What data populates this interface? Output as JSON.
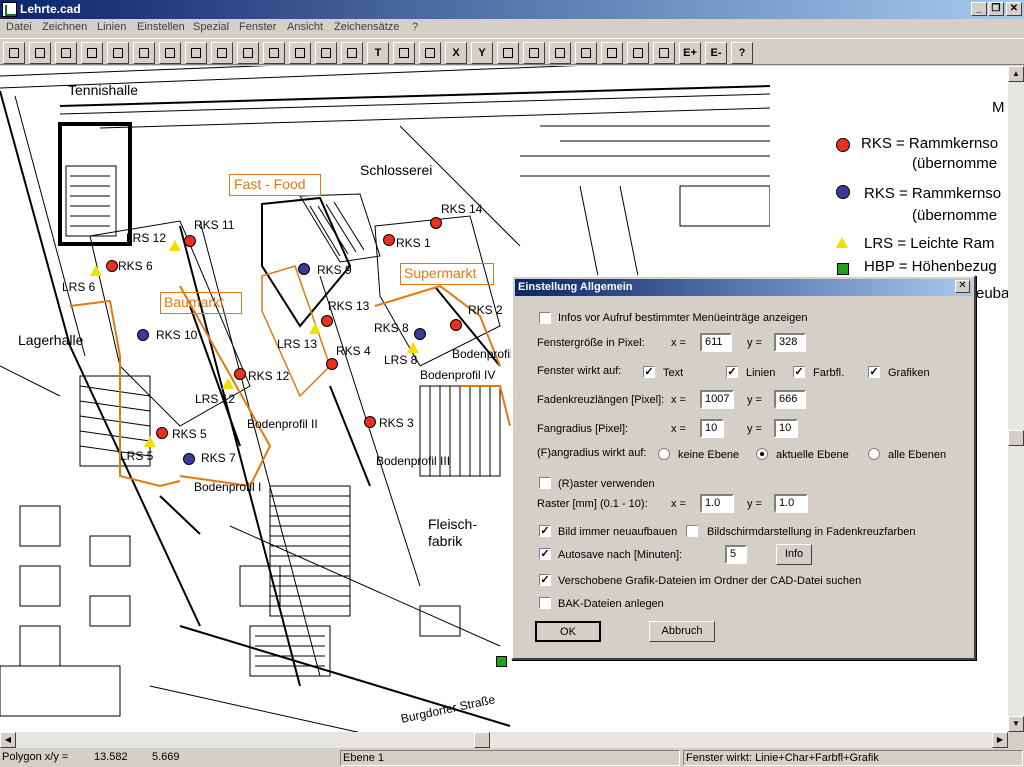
{
  "window": {
    "title": "Lehrte.cad"
  },
  "menu": [
    "Datei",
    "Zeichnen",
    "Linien",
    "Einstellen",
    "Spezial",
    "Fenster",
    "Ansicht",
    "Zeichensätze",
    "?"
  ],
  "toolbar": [
    {
      "icon": "new-file-icon"
    },
    {
      "icon": "open-folder-icon"
    },
    {
      "icon": "save-icon"
    },
    {
      "icon": "print-icon"
    },
    {
      "icon": "wrench-icon"
    },
    {
      "icon": "zoom-page-icon"
    },
    {
      "icon": "zoom-in-icon"
    },
    {
      "icon": "zoom-out-icon"
    },
    {
      "icon": "select-arrow-icon"
    },
    {
      "icon": "polygon-icon"
    },
    {
      "icon": "polyline-icon"
    },
    {
      "icon": "rectangle-icon"
    },
    {
      "icon": "circle-icon"
    },
    {
      "icon": "arc-icon"
    },
    {
      "icon": "text-tool-icon",
      "label": "T"
    },
    {
      "icon": "cut-red-icon"
    },
    {
      "icon": "scissors-icon"
    },
    {
      "icon": "x-axis-icon",
      "label": "X"
    },
    {
      "icon": "y-axis-icon",
      "label": "Y"
    },
    {
      "icon": "layers-icon"
    },
    {
      "icon": "eraser-icon"
    },
    {
      "icon": "edit-icon"
    },
    {
      "icon": "copy-icon"
    },
    {
      "icon": "window-icon"
    },
    {
      "icon": "pen-icon"
    },
    {
      "icon": "paint-icon"
    },
    {
      "icon": "level-up-icon",
      "label": "E+"
    },
    {
      "icon": "level-down-icon",
      "label": "E-"
    },
    {
      "icon": "help-icon",
      "label": "?"
    }
  ],
  "map_labels": {
    "tennishalle": "Tennishalle",
    "schlosserei": "Schlosserei",
    "fast_food": "Fast - Food",
    "supermarkt": "Supermarkt",
    "baumarkt": "Baumarkt",
    "lagerhalle": "Lagerhalle",
    "fleisch": "Fleisch-",
    "fabrik": "fabrik",
    "bodenprofil_1": "Bodenprofil I",
    "bodenprofil_2": "Bodenprofil II",
    "bodenprofil_3": "Bodenprofil III",
    "bodenprofil_4": "Bodenprofil IV",
    "bodenprofil_5": "Bodenprofil",
    "burgdorfer": "Burgdorfer Straße",
    "rks1": "RKS 1",
    "rks2": "RKS 2",
    "rks3": "RKS 3",
    "rks4": "RKS 4",
    "rks5": "RKS 5",
    "rks6": "RKS 6",
    "rks7": "RKS 7",
    "rks8": "RKS 8",
    "rks9": "RKS 9",
    "rks10": "RKS 10",
    "rks11": "RKS 11",
    "rks12": "RKS 12",
    "rks13": "RKS 13",
    "rks14": "RKS 14",
    "lrs5": "LRS 5",
    "lrs6": "LRS 6",
    "lrs8": "LRS 8",
    "lrs12a": "LRS 12",
    "lrs12b": "LRS 12",
    "lrs13": "LRS 13"
  },
  "legend": {
    "header": "M",
    "rks_red": "RKS = Rammkernso",
    "rks_red_sub": "(übernomme",
    "rks_blue": "RKS = Rammkernso",
    "rks_blue_sub": "(übernomme",
    "lrs": "LRS = Leichte Ram",
    "hbp": "HBP = Höhenbezug",
    "ueba": "euba",
    "colors": {
      "rks_red": "#e8321e",
      "rks_blue": "#3a3a9a",
      "lrs": "#f0e000",
      "hbp": "#20a020"
    }
  },
  "status": {
    "mode": "Polygon  x/y =",
    "x": "13.582",
    "y": "5.669",
    "layer": "Ebene 1",
    "window_info": "Fenster wirkt: Linie+Char+Farbfl+Grafik"
  },
  "dialog": {
    "title": "Einstellung Allgemein",
    "info_menu": "Infos vor Aufruf bestimmter Menüeinträge anzeigen",
    "window_size_label": "Fenstergröße in Pixel:",
    "x_label": "x =",
    "y_label": "y =",
    "window_x": "611",
    "window_y": "328",
    "window_affects_label": "Fenster wirkt auf:",
    "aff_text": "Text",
    "aff_lines": "Linien",
    "aff_fill": "Farbfl.",
    "aff_graphics": "Grafiken",
    "crosshair_label": "Fadenkreuzlängen [Pixel]:",
    "crosshair_x": "1007",
    "crosshair_y": "666",
    "catch_label": "Fangradius [Pixel]:",
    "catch_x": "10",
    "catch_y": "10",
    "catch_affects_label": "(F)angradius wirkt auf:",
    "radio_none": "keine Ebene",
    "radio_current": "aktuelle Ebene",
    "radio_all": "alle Ebenen",
    "use_grid": "(R)aster verwenden",
    "grid_label": "Raster [mm] (0.1 - 10):",
    "grid_x": "1.0",
    "grid_y": "1.0",
    "always_redraw": "Bild immer neuaufbauen",
    "screen_crosshair": "Bildschirmdarstellung in Fadenkreuzfarben",
    "autosave": "Autosave nach [Minuten]:",
    "autosave_val": "5",
    "info_btn": "Info",
    "moved_graphics": "Verschobene Grafik-Dateien im Ordner der CAD-Datei suchen",
    "bak_files": "BAK-Dateien anlegen",
    "ok": "OK",
    "cancel": "Abbruch"
  }
}
